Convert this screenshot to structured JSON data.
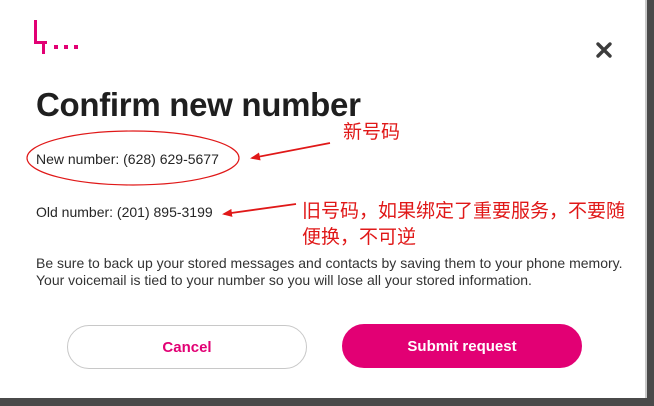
{
  "dialog": {
    "brand_icon": "t-mobile-logo",
    "close_icon": "close-icon",
    "title": "Confirm new number",
    "new_number": "New number: (628) 629-5677",
    "old_number": "Old number: (201) 895-3199",
    "info_text": "Be sure to back up your stored messages and contacts by saving them to your phone memory. Your voicemail is tied to your number so you will lose all your stored information.",
    "cancel_label": "Cancel",
    "submit_label": "Submit request"
  },
  "annotations": {
    "new_number_note": "新号码",
    "old_number_note": "旧号码，如果绑定了重要服务，不要随便换，不可逆"
  },
  "colors": {
    "brand": "#e20074",
    "annotation": "#e01818",
    "title": "#1f1f1f"
  }
}
